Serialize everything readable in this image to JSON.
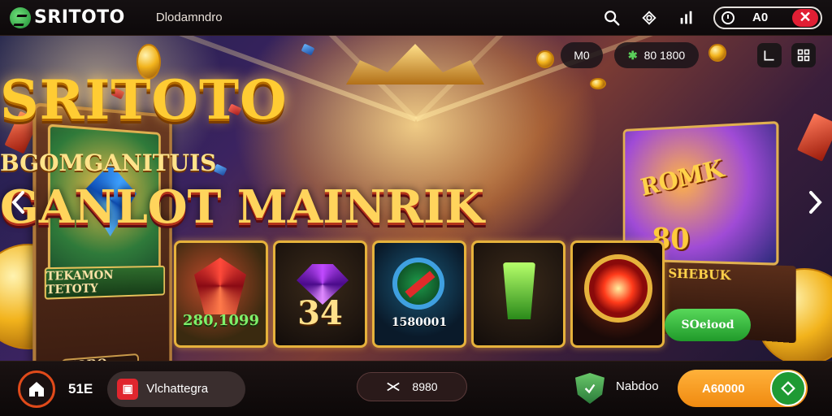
{
  "topbar": {
    "brand": "SRITOTO",
    "subtitle": "Dlodamndro",
    "status_level": "A0",
    "close_symbol": "✕"
  },
  "hero": {
    "pill_left": "M0",
    "pill_balance": "80 1800",
    "title_main": "SRITOTO",
    "title_sub": "BGOMGANITUIS",
    "title_game": "GANLOT MAINRIK",
    "left_slot_plate": "TEKAMON TETOTY",
    "left_slot_button": "MOBO BUIL",
    "right_slot_title": "ROMK",
    "right_slot_number": "80",
    "right_slot_sub": "SHEBUK",
    "green_button": "SOeiood"
  },
  "cards": [
    {
      "id": "c1",
      "label": "280,1099"
    },
    {
      "id": "c2",
      "label": "34"
    },
    {
      "id": "c3",
      "label": "1580001"
    },
    {
      "id": "c4",
      "label": ""
    },
    {
      "id": "c5",
      "label": ""
    }
  ],
  "bottombar": {
    "count": "51E",
    "game_label": "Vlchattegra",
    "mid_value": "8980",
    "nav_label": "Nabdoo",
    "orange_button": "A60000"
  },
  "icons": {
    "search": "search-icon",
    "share": "share-icon",
    "signal": "signal-icon",
    "home": "home-icon"
  },
  "colors": {
    "accent_gold": "#ffcc33",
    "accent_orange": "#f08a10",
    "accent_green": "#209a2a",
    "danger_red": "#e11f34"
  }
}
